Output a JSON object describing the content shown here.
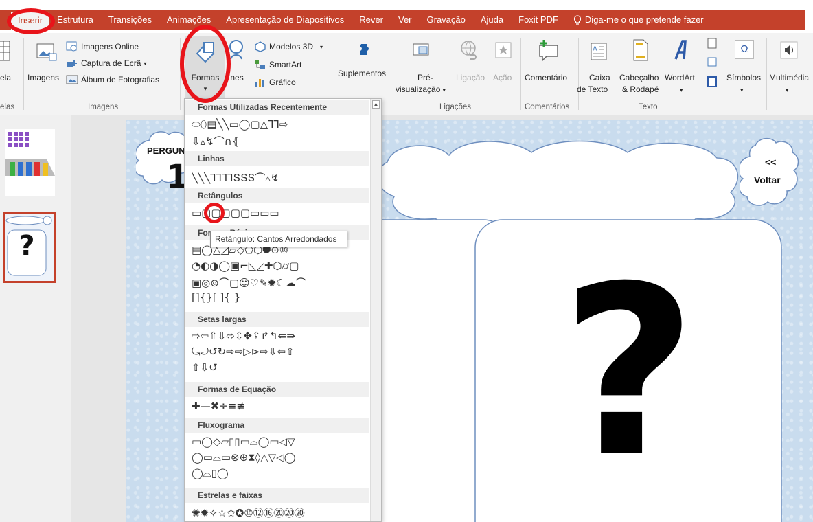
{
  "menu": {
    "tabs": [
      "Inserir",
      "Estrutura",
      "Transições",
      "Animações",
      "Apresentação de Diapositivos",
      "Rever",
      "Ver",
      "Gravação",
      "Ajuda",
      "Foxit PDF"
    ],
    "tell_me": "Diga-me o que pretende fazer"
  },
  "ribbon": {
    "tabela_partial": "ela",
    "imagens": "Imagens",
    "imagens_online": "Imagens Online",
    "captura": "Captura de Ecrã",
    "album": "Álbum de Fotografias",
    "formas": "Formas",
    "icones_partial": "Í",
    "icones_rest": "nes",
    "modelos3d": "Modelos 3D",
    "smartart": "SmartArt",
    "grafico": "Gráfico",
    "suplementos": "Suplementos",
    "pre_visualizacao_1": "Pré-",
    "pre_visualizacao_2": "visualização",
    "ligacao": "Ligação",
    "acao": "Ação",
    "comentario": "Comentário",
    "caixa_1": "Caixa",
    "caixa_2": "de Texto",
    "cabecalho_1": "Cabeçalho",
    "cabecalho_2": "& Rodapé",
    "wordart": "WordArt",
    "simbolos": "Símbolos",
    "multimedia": "Multimédia",
    "groups": {
      "tabelas_partial": "elas",
      "imagens": "Imagens",
      "ligacoes": "Ligações",
      "comentarios": "Comentários",
      "texto": "Texto"
    }
  },
  "dropdown": {
    "sections": [
      {
        "title": "Formas Utilizadas Recentemente",
        "rows": [
          "⬭⬯▤╲╲▭◯▢△⅂⅂⇨",
          "⇩▵↯⌒∩⦃"
        ]
      },
      {
        "title": "Linhas",
        "rows": [
          "╲╲╲⅂⅂⅂⅂ՏՏՏ⌒▵↯"
        ]
      },
      {
        "title": "Retângulos",
        "rows": [
          "▭▢▢▢▢▢▭▭▭"
        ]
      },
      {
        "title": "Formas Básicas",
        "rows": [
          "▤◯△◿▱◇⬠⬡⯃⊙⑩",
          "◔◐◑◯▣⌐◺◿✚⬡⌭▢",
          "▣◎⊚⌒▢☺♡✎✹☾☁⌒",
          "[]{}[ ]{ }"
        ]
      },
      {
        "title": "Setas largas",
        "rows": [
          "⇨⇦⇧⇩⬄⇳✥⇪↱↰⇚⇛",
          "⤿⤾↺↻⇨⇨▷⊳⇨⇩⇦⇧",
          "⇧⇩↺"
        ]
      },
      {
        "title": "Formas de Equação",
        "rows": [
          "✚—✖÷≡≢"
        ]
      },
      {
        "title": "Fluxograma",
        "rows": [
          "▭◯◇▱▯▯▭⌓◯▭◁▽",
          "◯▭⌓▭⊗⊕⧗◊△▽◁◯",
          "◯⌓▯◯"
        ]
      },
      {
        "title": "Estrelas e faixas",
        "rows": [
          "✺✹✧☆✩✪⑩⑫⑯⑳⑳⑳"
        ]
      }
    ],
    "tooltip": "Retângulo: Cantos Arredondados"
  },
  "slide": {
    "question_label": "PERGUN",
    "question_number": "1",
    "back_line1": "<<",
    "back_line2": "Voltar",
    "question_mark": "?"
  },
  "thumbnails": {
    "thumb2_mark": "?"
  },
  "colors": {
    "accent": "#c4412b",
    "highlight": "#e8141a",
    "slide_bg": "#c9dcee",
    "cloud_stroke": "#6f8fbf"
  }
}
